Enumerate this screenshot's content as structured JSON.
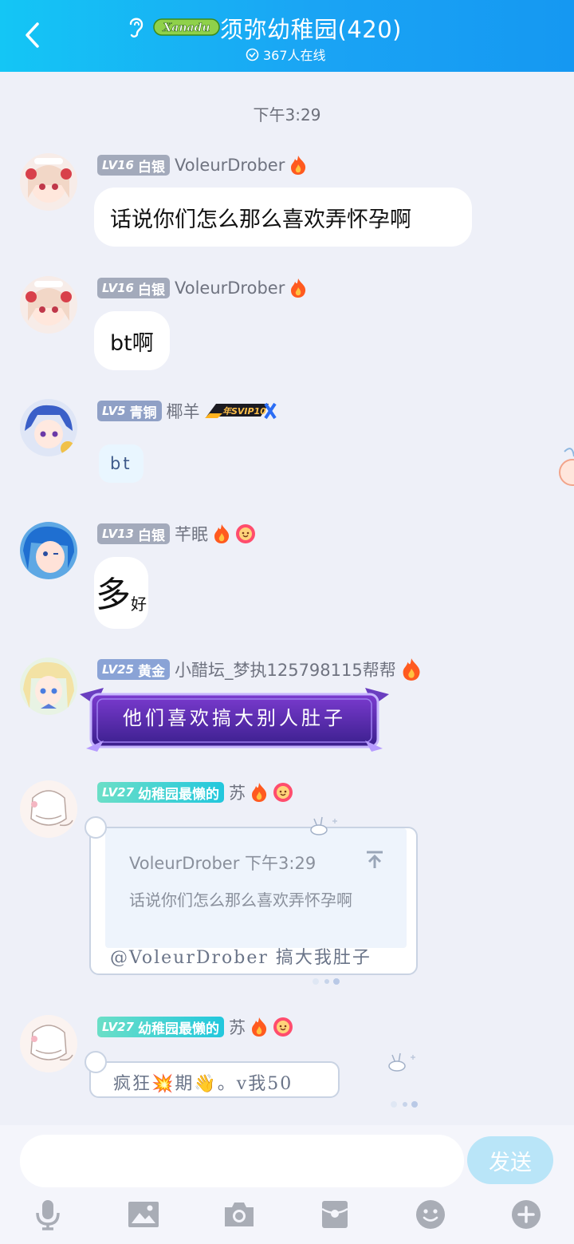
{
  "header": {
    "title": "须弥幼稚园(420)",
    "logo_text": "Xanadu",
    "online": "367人在线"
  },
  "time_separator": "下午3:29",
  "messages": [
    {
      "level": "LV16",
      "rank": "白银",
      "name": "VoleurDrober",
      "text": "话说你们怎么那么喜欢弄怀孕啊"
    },
    {
      "level": "LV16",
      "rank": "白银",
      "name": "VoleurDrober",
      "text": "bt啊"
    },
    {
      "level": "LV5",
      "rank": "青铜",
      "name": "椰羊",
      "badge": "年SVIP10",
      "text": "bt"
    },
    {
      "level": "LV13",
      "rank": "白银",
      "name": "芊眠",
      "text_big": "多",
      "text_small": "好"
    },
    {
      "level": "LV25",
      "rank": "黄金",
      "name": "小醋坛_梦执125798115帮帮",
      "text": "他们喜欢搞大别人肚子"
    },
    {
      "level": "LV27",
      "rank": "幼稚园最懒的",
      "name": "苏",
      "quote": {
        "author": "VoleurDrober",
        "time": "下午3:29",
        "text": "话说你们怎么那么喜欢弄怀孕啊"
      },
      "text": "@VoleurDrober 搞大我肚子"
    },
    {
      "level": "LV27",
      "rank": "幼稚园最懒的",
      "name": "苏",
      "text": "疯狂💥期👋。v我50"
    }
  ],
  "input": {
    "placeholder": "",
    "send_label": "发送"
  },
  "toolbar": [
    "mic-icon",
    "image-icon",
    "camera-icon",
    "red-packet-icon",
    "emoji-icon",
    "plus-icon"
  ],
  "colors": {
    "header_start": "#14c6f5",
    "header_end": "#1598f2",
    "send_bg": "#b9e5f8",
    "background": "#eef0f8"
  }
}
